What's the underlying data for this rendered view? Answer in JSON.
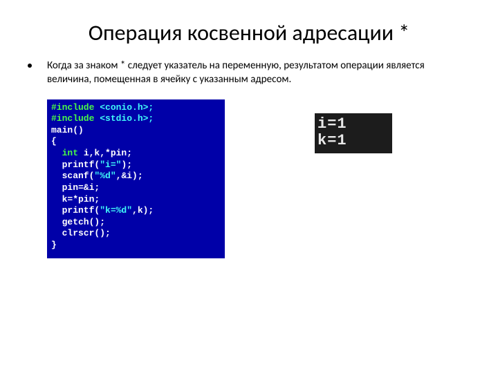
{
  "title": "Операция косвенной адресации *",
  "bullet": "Когда за знаком * следует указатель на переменную, результатом операции является величина, помещенная в ячейку с указанным адресом.",
  "code": {
    "l1a": "#include ",
    "l1b": "<conio.h>;",
    "l2a": "#include ",
    "l2b": "<stdio.h>;",
    "l3": "main()",
    "l4": "{",
    "l5a": "  int ",
    "l5b": "i,k,*pin;",
    "l6a": "  printf(",
    "l6b": "\"i=\"",
    "l6c": ");",
    "l7a": "  scanf(",
    "l7b": "\"%d\"",
    "l7c": ",&i);",
    "l8": "  pin=&i;",
    "l9": "  k=*pin;",
    "l10a": "  printf(",
    "l10b": "\"k=%d\"",
    "l10c": ",k);",
    "l11": "  getch();",
    "l12": "  clrscr();",
    "l13": "}"
  },
  "output": {
    "line1": "i=1",
    "line2": "k=1"
  }
}
